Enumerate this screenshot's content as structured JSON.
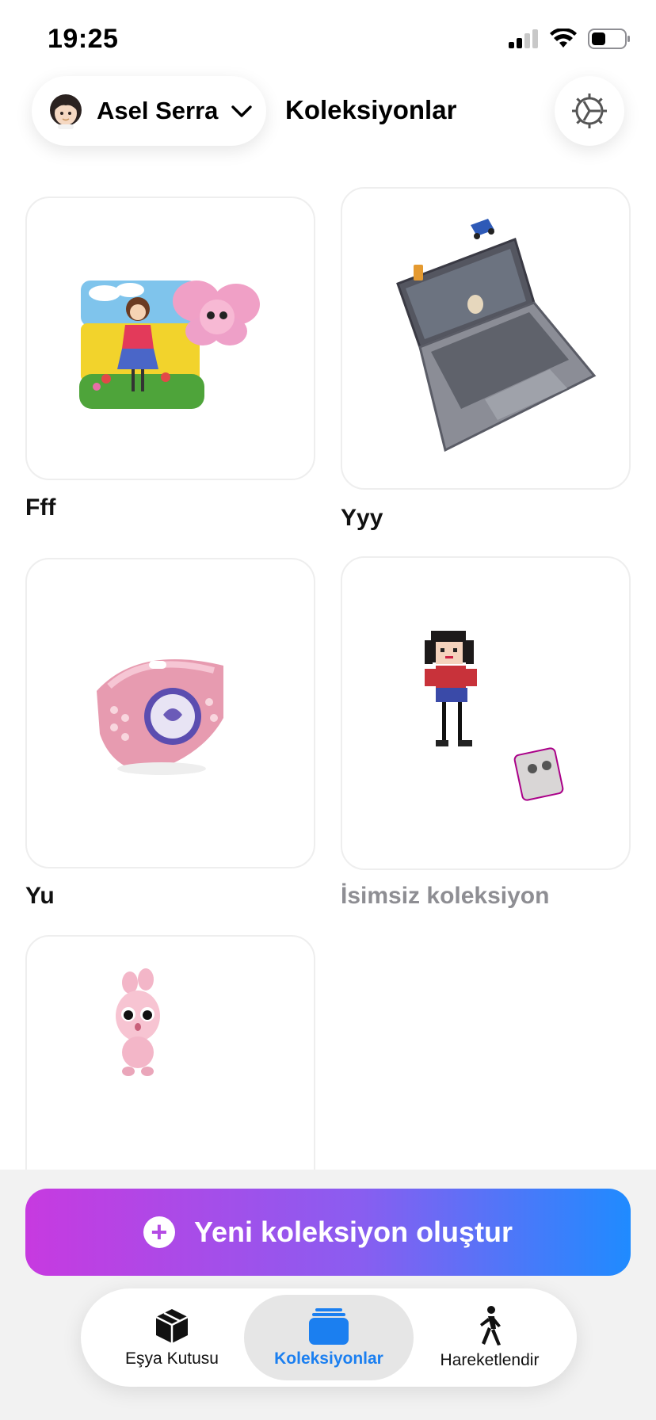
{
  "status_bar": {
    "time": "19:25",
    "icons": [
      "cellular-signal-icon",
      "wifi-icon",
      "battery-icon"
    ]
  },
  "header": {
    "profile_name": "Asel Serra",
    "title": "Koleksiyonlar",
    "settings_icon": "gear-icon"
  },
  "collections": [
    {
      "label": "Fff"
    },
    {
      "label": "Yyy"
    },
    {
      "label": "Yu"
    },
    {
      "label": "İsimsiz koleksiyon"
    },
    {
      "label": ""
    }
  ],
  "create_button": {
    "label": "Yeni koleksiyon oluştur"
  },
  "tabs": [
    {
      "label": "Eşya Kutusu",
      "icon": "box-icon"
    },
    {
      "label": "Koleksiyonlar",
      "icon": "collections-stack-icon",
      "active": true
    },
    {
      "label": "Hareketlendir",
      "icon": "walking-person-icon"
    }
  ],
  "colors": {
    "accent_blue": "#1b7ff0",
    "gradient_start": "#c73ae0",
    "gradient_end": "#1f8bff"
  }
}
